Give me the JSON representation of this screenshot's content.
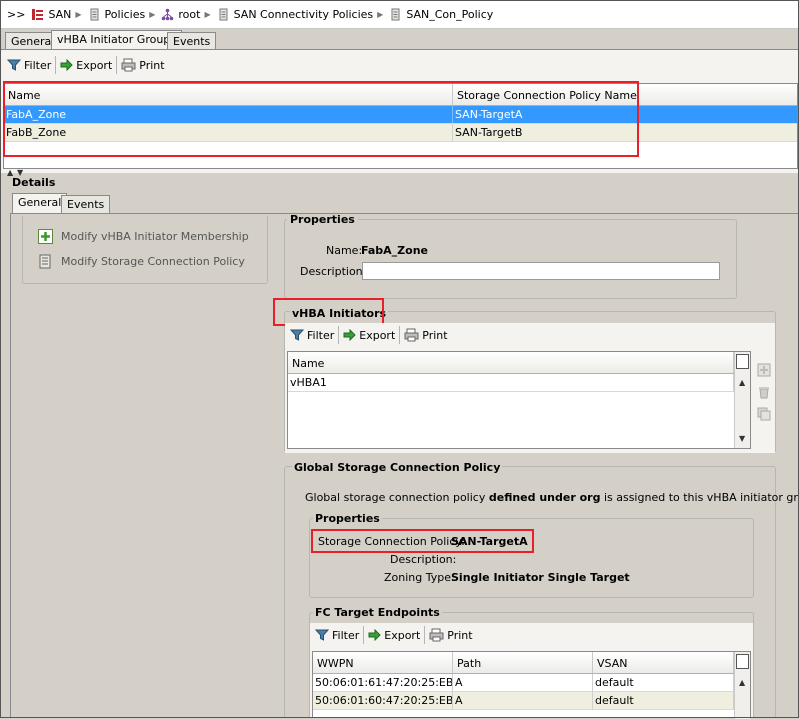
{
  "breadcrumb": {
    "prefix": ">>",
    "items": [
      {
        "label": "SAN",
        "icon": "san-icon"
      },
      {
        "label": "Policies",
        "icon": "policy-scroll-icon"
      },
      {
        "label": "root",
        "icon": "org-tree-icon"
      },
      {
        "label": "SAN Connectivity Policies",
        "icon": "policy-scroll-icon"
      },
      {
        "label": "SAN_Con_Policy",
        "icon": "policy-scroll-icon"
      }
    ]
  },
  "top_tabs": [
    "General",
    "vHBA Initiator Groups",
    "Events"
  ],
  "toolbar": {
    "filter": "Filter",
    "export": "Export",
    "print": "Print"
  },
  "groups_table": {
    "columns": [
      "Name",
      "Storage Connection Policy Name"
    ],
    "rows": [
      [
        "FabA_Zone",
        "SAN-TargetA"
      ],
      [
        "FabB_Zone",
        "SAN-TargetB"
      ]
    ]
  },
  "details": {
    "title": "Details",
    "tabs": [
      "General",
      "Events"
    ],
    "actions": [
      "Modify vHBA Initiator Membership",
      "Modify Storage Connection Policy"
    ],
    "properties": {
      "legend": "Properties",
      "name_label": "Name:",
      "name_value": "FabA_Zone",
      "description_label": "Description:",
      "description_value": ""
    },
    "vhba": {
      "legend": "vHBA Initiators",
      "columns": [
        "Name"
      ],
      "rows": [
        "vHBA1"
      ]
    },
    "global": {
      "legend": "Global Storage Connection Policy",
      "desc_pre": "Global storage connection policy ",
      "desc_bold": "defined under org",
      "desc_post": " is assigned to this vHBA initiator group.",
      "props_legend": "Properties",
      "scp_label": "Storage Connection Policy:",
      "scp_value": "SAN-TargetA",
      "desc_label": "Description:",
      "desc_value": "",
      "zoning_label": "Zoning Type:",
      "zoning_value": "Single Initiator Single Target",
      "fc_legend": "FC Target Endpoints",
      "fc_columns": [
        "WWPN",
        "Path",
        "VSAN"
      ],
      "fc_rows": [
        [
          "50:06:01:61:47:20:25:EB",
          "A",
          "default"
        ],
        [
          "50:06:01:60:47:20:25:EB",
          "A",
          "default"
        ]
      ]
    }
  },
  "colors": {
    "selection": "#3399ff",
    "highlight_box": "#e8202a",
    "panel": "#d4d0c8"
  }
}
